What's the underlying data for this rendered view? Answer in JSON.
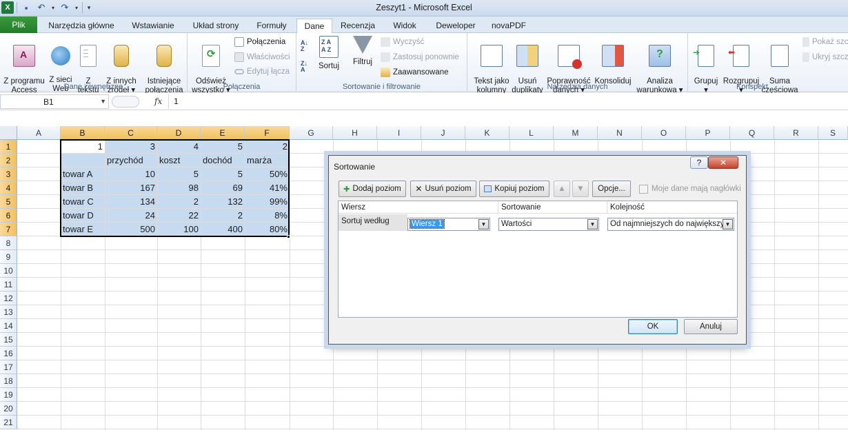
{
  "window": {
    "title": "Zeszyt1  -  Microsoft Excel"
  },
  "qat": {
    "icons": [
      "excel-logo-icon",
      "save-icon",
      "undo-icon",
      "redo-icon",
      "customize-icon"
    ]
  },
  "tabs": {
    "file": "Plik",
    "items": [
      "Narzędzia główne",
      "Wstawianie",
      "Układ strony",
      "Formuły",
      "Dane",
      "Recenzja",
      "Widok",
      "Deweloper",
      "novaPDF"
    ],
    "active": "Dane"
  },
  "ribbon": {
    "external": {
      "label": "Dane zewnętrzne",
      "access": "Z programu\nAccess",
      "web": "Z sieci\nWeb",
      "text": "Z\ntekstu",
      "other": "Z innych\nźródeł ▾",
      "existing": "Istniejące\npołączenia"
    },
    "connections": {
      "label": "Połączenia",
      "refresh": "Odśwież\nwszystko ▾",
      "connections": "Połączenia",
      "properties": "Właściwości",
      "edit_links": "Edytuj łącza"
    },
    "sort": {
      "label": "Sortowanie i filtrowanie",
      "sort": "Sortuj",
      "filter": "Filtruj",
      "clear": "Wyczyść",
      "reapply": "Zastosuj ponownie",
      "advanced": "Zaawansowane"
    },
    "tools": {
      "label": "Narzędzia danych",
      "text_to_columns": "Tekst jako\nkolumny",
      "remove_duplicates": "Usuń\nduplikaty",
      "validation": "Poprawność\ndanych ▾",
      "consolidate": "Konsoliduj",
      "whatif": "Analiza\nwarunkowa ▾"
    },
    "outline": {
      "label": "Konspekt",
      "group": "Grupuj\n▾",
      "ungroup": "Rozgrupuj\n▾",
      "subtotal": "Suma\nczęściowa",
      "show": "Pokaż szczegóły",
      "hide": "Ukryj szczegóły"
    }
  },
  "formula_bar": {
    "name_box": "B1",
    "fx": "fx",
    "value": "1"
  },
  "sheet": {
    "columns": [
      "A",
      "B",
      "C",
      "D",
      "E",
      "F",
      "G",
      "H",
      "I",
      "J",
      "K",
      "L",
      "M",
      "N",
      "O",
      "P",
      "Q",
      "R",
      "S"
    ],
    "rows": [
      "1",
      "2",
      "3",
      "4",
      "5",
      "6",
      "7",
      "8",
      "9",
      "10",
      "11",
      "12",
      "13",
      "14",
      "15",
      "16",
      "17",
      "18",
      "19",
      "20",
      "21"
    ],
    "cells": {
      "B1": "1",
      "C1": "3",
      "D1": "4",
      "E1": "5",
      "F1": "2",
      "C2": "przychód",
      "D2": "koszt",
      "E2": "dochód",
      "F2": "marża",
      "B3": "towar A",
      "C3": "10",
      "D3": "5",
      "E3": "5",
      "F3": "50%",
      "B4": "towar B",
      "C4": "167",
      "D4": "98",
      "E4": "69",
      "F4": "41%",
      "B5": "towar C",
      "C5": "134",
      "D5": "2",
      "E5": "132",
      "F5": "99%",
      "B6": "towar D",
      "C6": "24",
      "D6": "22",
      "E6": "2",
      "F6": "8%",
      "B7": "towar E",
      "C7": "500",
      "D7": "100",
      "E7": "400",
      "F7": "80%"
    }
  },
  "dialog": {
    "title": "Sortowanie",
    "help": "?",
    "close": "✕",
    "add_level": "Dodaj poziom",
    "delete_level": "Usuń poziom",
    "copy_level": "Kopiuj poziom",
    "move_up": "▲",
    "move_down": "▼",
    "options": "Opcje...",
    "headers_checkbox": "Moje dane mają nagłówki",
    "col_row": "Wiersz",
    "col_sort_on": "Sortowanie",
    "col_order": "Kolejność",
    "row_label": "Sortuj według",
    "row_value": "Wiersz 1",
    "sort_on_value": "Wartości",
    "order_value": "Od najmniejszych do największych",
    "ok": "OK",
    "cancel": "Anuluj"
  }
}
